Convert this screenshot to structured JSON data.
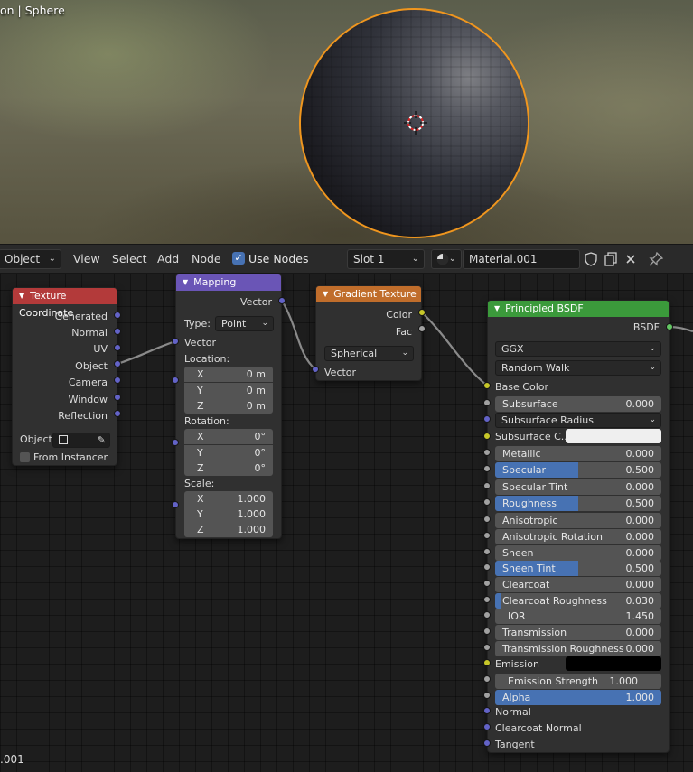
{
  "viewport": {
    "title": "on | Sphere"
  },
  "header": {
    "editor_mode": "Object",
    "menus": [
      "View",
      "Select",
      "Add",
      "Node"
    ],
    "use_nodes_label": "Use Nodes",
    "use_nodes_checked": true,
    "slot": "Slot 1",
    "material_name": "Material.001"
  },
  "footer": {
    "text": ".001"
  },
  "nodes": {
    "texture_coordinate": {
      "title": "Texture Coordinate",
      "color": "#b33a3a",
      "outputs": [
        "Generated",
        "Normal",
        "UV",
        "Object",
        "Camera",
        "Window",
        "Reflection"
      ],
      "object_label": "Object:",
      "from_instancer_label": "From Instancer",
      "from_instancer_checked": false
    },
    "mapping": {
      "title": "Mapping",
      "color": "#6a55b6",
      "output": "Vector",
      "type_label": "Type:",
      "type_value": "Point",
      "input_vector": "Vector",
      "location_label": "Location:",
      "location": [
        {
          "axis": "X",
          "value": "0 m"
        },
        {
          "axis": "Y",
          "value": "0 m"
        },
        {
          "axis": "Z",
          "value": "0 m"
        }
      ],
      "rotation_label": "Rotation:",
      "rotation": [
        {
          "axis": "X",
          "value": "0°"
        },
        {
          "axis": "Y",
          "value": "0°"
        },
        {
          "axis": "Z",
          "value": "0°"
        }
      ],
      "scale_label": "Scale:",
      "scale": [
        {
          "axis": "X",
          "value": "1.000"
        },
        {
          "axis": "Y",
          "value": "1.000"
        },
        {
          "axis": "Z",
          "value": "1.000"
        }
      ]
    },
    "gradient_texture": {
      "title": "Gradient Texture",
      "color": "#c06d2b",
      "out_color": "Color",
      "out_fac": "Fac",
      "type_value": "Spherical",
      "input_vector": "Vector"
    },
    "principled": {
      "title": "Principled BSDF",
      "color": "#3b9a3b",
      "output": "BSDF",
      "distribution": "GGX",
      "subsurface_method": "Random Walk",
      "base_color": "Base Color",
      "subsurface": {
        "label": "Subsurface",
        "value": "0.000"
      },
      "subsurface_radius": "Subsurface Radius",
      "subsurface_color": "Subsurface C...",
      "metallic": {
        "label": "Metallic",
        "value": "0.000"
      },
      "specular": {
        "label": "Specular",
        "value": "0.500",
        "fill": 0.5
      },
      "specular_tint": {
        "label": "Specular Tint",
        "value": "0.000"
      },
      "roughness": {
        "label": "Roughness",
        "value": "0.500",
        "fill": 0.5
      },
      "anisotropic": {
        "label": "Anisotropic",
        "value": "0.000"
      },
      "anisotropic_rotation": {
        "label": "Anisotropic Rotation",
        "value": "0.000"
      },
      "sheen": {
        "label": "Sheen",
        "value": "0.000"
      },
      "sheen_tint": {
        "label": "Sheen Tint",
        "value": "0.500",
        "fill": 0.5
      },
      "clearcoat": {
        "label": "Clearcoat",
        "value": "0.000"
      },
      "clearcoat_roughness": {
        "label": "Clearcoat Roughness",
        "value": "0.030",
        "fill": 0.03
      },
      "ior": {
        "label": "IOR",
        "value": "1.450"
      },
      "transmission": {
        "label": "Transmission",
        "value": "0.000"
      },
      "transmission_roughness": {
        "label": "Transmission Roughness",
        "value": "0.000"
      },
      "emission": "Emission",
      "emission_strength": {
        "label": "Emission Strength",
        "value": "1.000"
      },
      "alpha": {
        "label": "Alpha",
        "value": "1.000",
        "fill": 1.0
      },
      "normal": "Normal",
      "clearcoat_normal": "Clearcoat Normal",
      "tangent": "Tangent"
    }
  },
  "icons": {
    "use_nodes_check": "✓",
    "chevron": "⌄",
    "node_arrow": "▼"
  }
}
